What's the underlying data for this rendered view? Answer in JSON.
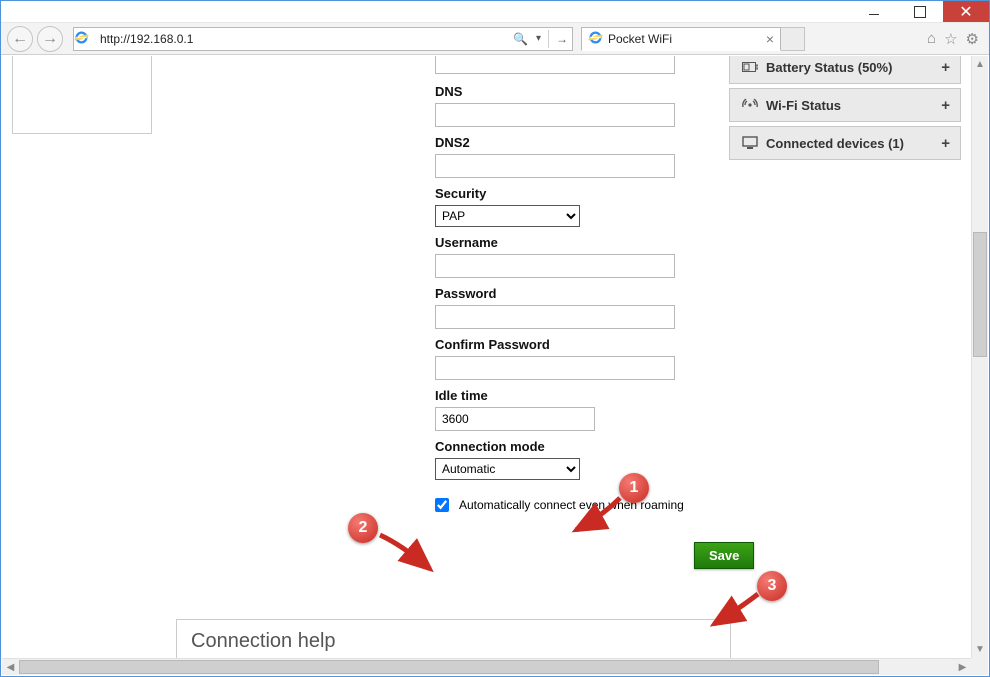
{
  "browser": {
    "url": "http://192.168.0.1",
    "tab_title": "Pocket WiFi"
  },
  "sidebar": {
    "battery": {
      "label": "Battery Status (50%)"
    },
    "wifi": {
      "label": "Wi-Fi Status"
    },
    "devices": {
      "label": "Connected devices (1)"
    }
  },
  "form": {
    "dns_label": "DNS",
    "dns_value": "",
    "dns2_label": "DNS2",
    "dns2_value": "",
    "security_label": "Security",
    "security_value": "PAP",
    "username_label": "Username",
    "username_value": "",
    "password_label": "Password",
    "password_value": "",
    "confirm_label": "Confirm Password",
    "confirm_value": "",
    "idle_label": "Idle time",
    "idle_value": "3600",
    "connmode_label": "Connection mode",
    "connmode_value": "Automatic",
    "roaming_label": "Automatically connect even when roaming",
    "save_label": "Save"
  },
  "help": {
    "title": "Connection help"
  },
  "annotations": {
    "b1": "1",
    "b2": "2",
    "b3": "3"
  }
}
